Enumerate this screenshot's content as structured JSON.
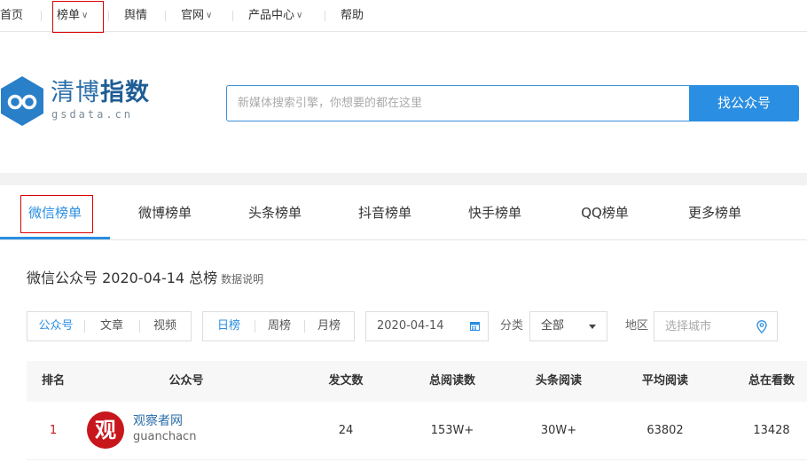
{
  "topnav": {
    "items": [
      {
        "label": "首页"
      },
      {
        "label": "榜单"
      },
      {
        "label": "舆情"
      },
      {
        "label": "官网"
      },
      {
        "label": "产品中心"
      },
      {
        "label": "帮助"
      }
    ]
  },
  "brand": {
    "name_cn_a": "清博",
    "name_cn_b": "指数",
    "name_en": "gsdata.cn"
  },
  "search": {
    "placeholder": "新媒体搜索引擎，你想要的都在这里",
    "button_label": "找公众号"
  },
  "tabs": [
    {
      "label": "微信榜单"
    },
    {
      "label": "微博榜单"
    },
    {
      "label": "头条榜单"
    },
    {
      "label": "抖音榜单"
    },
    {
      "label": "快手榜单"
    },
    {
      "label": "QQ榜单"
    },
    {
      "label": "更多榜单"
    }
  ],
  "ranking": {
    "title": "微信公众号 2020-04-14 总榜",
    "note": "数据说明"
  },
  "filters": {
    "type_options": [
      "公众号",
      "文章",
      "视频"
    ],
    "period_options": [
      "日榜",
      "周榜",
      "月榜"
    ],
    "date_value": "2020-04-14",
    "category_label": "分类",
    "category_value": "全部",
    "region_label": "地区",
    "city_placeholder": "选择城市"
  },
  "table": {
    "headers": [
      "排名",
      "公众号",
      "发文数",
      "总阅读数",
      "头条阅读",
      "平均阅读",
      "总在看数"
    ],
    "rows": [
      {
        "rank": "1",
        "avatar_char": "观",
        "name": "观察者网",
        "account_id": "guanchacn",
        "posts": "24",
        "total_reads": "153W+",
        "headline_reads": "30W+",
        "avg_reads": "63802",
        "total_watching": "13428"
      }
    ]
  },
  "colors": {
    "accent": "#2a8ee2",
    "rank_red": "#c8161d",
    "highlight_box": "#dd0000"
  }
}
